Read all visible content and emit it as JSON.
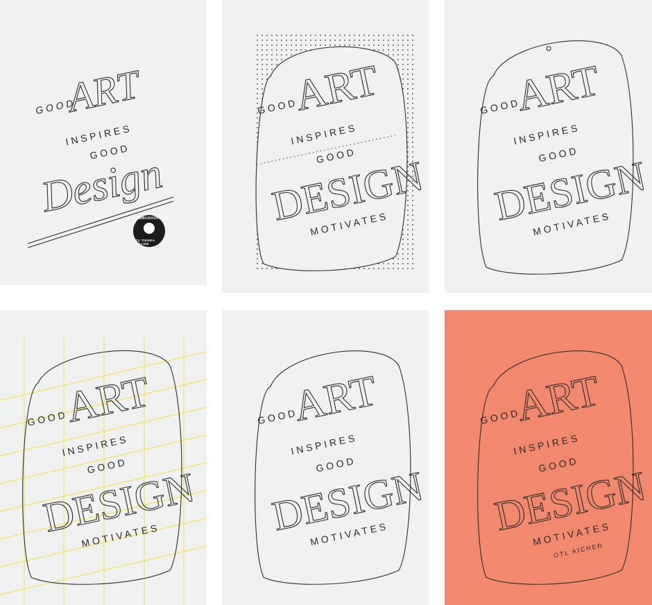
{
  "colors": {
    "panel_gray": "#f0f1f1",
    "panel_coral": "#f2896e",
    "grid_yellow": "#f5e35a",
    "ink": "#2a2a2a"
  },
  "lettering": {
    "good": "GOOD",
    "art": "ART",
    "inspires": "INSPIRES",
    "good2": "GOOD",
    "design_script": "Design",
    "design_caps": "DESIGN",
    "motivates": "MOTIVATES",
    "author": "OTL AICHER"
  },
  "badge": {
    "top": "OMBUSHOP.COM",
    "bottom": "TU TIENDA ONLINE"
  }
}
